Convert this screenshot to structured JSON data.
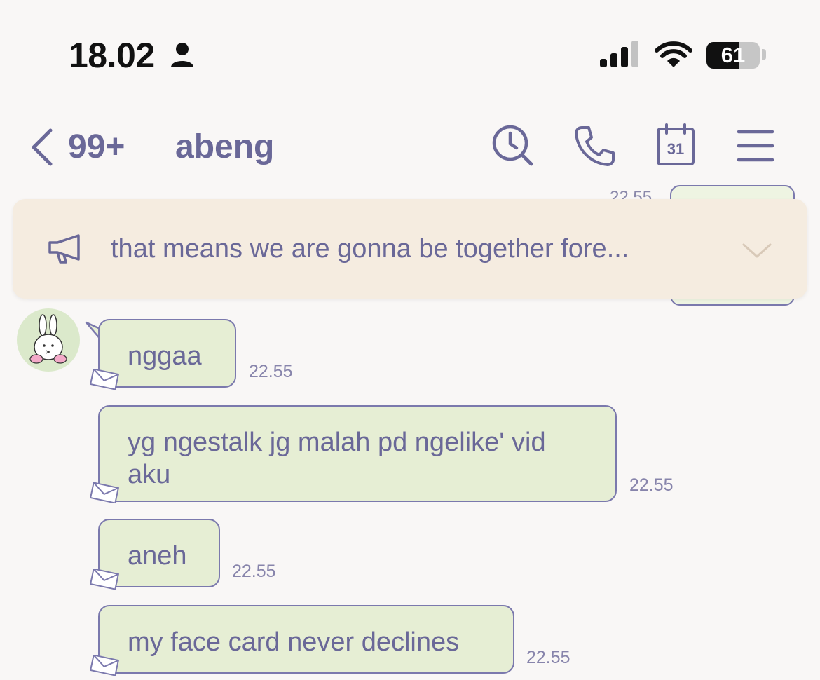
{
  "status_bar": {
    "time": "18.02",
    "battery_level": "61",
    "battery_fraction": 0.61
  },
  "header": {
    "unread_count": "99+",
    "title": "abeng",
    "icons": [
      "back-chevron-icon",
      "search-icon",
      "phone-icon",
      "calendar-icon",
      "menu-icon"
    ],
    "calendar_day": "31"
  },
  "peek_message": {
    "time": "22.55"
  },
  "announcement": {
    "text": "that means we are gonna be together fore..."
  },
  "messages": [
    {
      "text": "nggaa",
      "time": "22.55"
    },
    {
      "text": "yg ngestalk jg malah pd ngelike' vid aku",
      "time": "22.55"
    },
    {
      "text": "aneh",
      "time": "22.55"
    },
    {
      "text": "my face card never declines",
      "time": "22.55"
    }
  ],
  "colors": {
    "accent": "#6a6898",
    "bubble_bg": "#e6eed4",
    "bubble_border": "#7b79ad",
    "banner_bg": "#f5ece0",
    "background": "#f9f7f6"
  }
}
